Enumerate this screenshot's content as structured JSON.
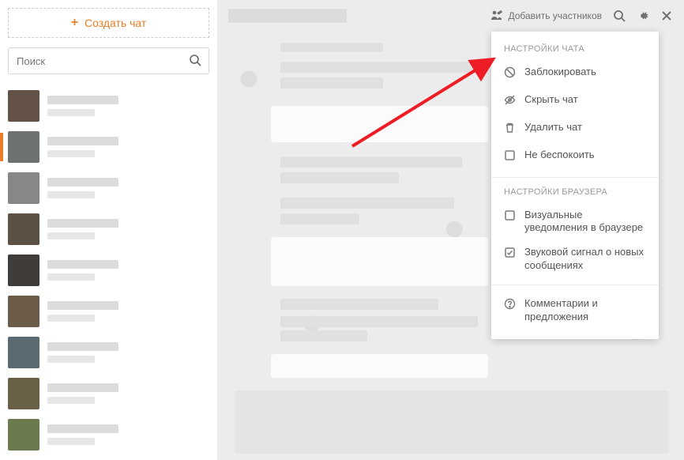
{
  "sidebar": {
    "create_label": "Создать чат",
    "search_placeholder": "Поиск",
    "chats": [
      {
        "avatar_color": "#645247"
      },
      {
        "avatar_color": "#6b726f",
        "active": true
      },
      {
        "avatar_color": "#878787"
      },
      {
        "avatar_color": "#5d5146"
      },
      {
        "avatar_color": "#3f3c3a"
      },
      {
        "avatar_color": "#6d5c4a"
      },
      {
        "avatar_color": "#5a6a70"
      },
      {
        "avatar_color": "#6a5f47"
      },
      {
        "avatar_color": "#6b7a4f"
      }
    ]
  },
  "header": {
    "add_participants_label": "Добавить участников"
  },
  "settings": {
    "chat_section_title": "НАСТРОЙКИ ЧАТА",
    "browser_section_title": "НАСТРОЙКИ БРАУЗЕРА",
    "block_label": "Заблокировать",
    "hide_label": "Скрыть чат",
    "delete_label": "Удалить чат",
    "dnd_label": "Не беспокоить",
    "visual_notif_label": "Визуальные уведомления в браузере",
    "sound_notif_label": "Звуковой сигнал о новых сообщениях",
    "feedback_label": "Комментарии и предложения"
  },
  "colors": {
    "accent": "#e87e27",
    "arrow": "#ee1c25"
  }
}
